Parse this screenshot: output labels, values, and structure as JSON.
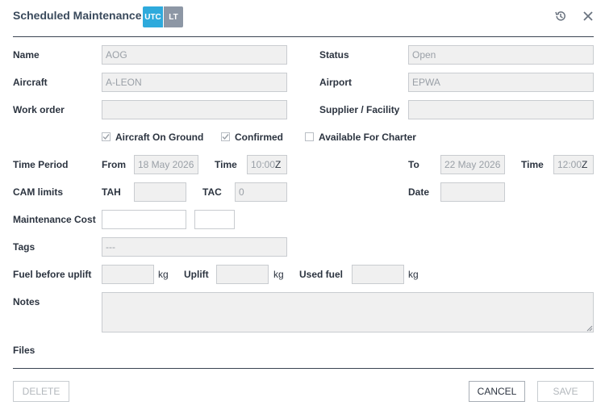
{
  "header": {
    "title": "Scheduled Maintenance",
    "tz_utc": "UTC",
    "tz_lt": "LT",
    "history_icon": "history-icon",
    "close_icon": "close-icon"
  },
  "labels": {
    "name": "Name",
    "status": "Status",
    "aircraft": "Aircraft",
    "airport": "Airport",
    "work_order": "Work order",
    "supplier": "Supplier / Facility",
    "time_period": "Time Period",
    "from": "From",
    "time": "Time",
    "to": "To",
    "cam_limits": "CAM limits",
    "tah": "TAH",
    "tac": "TAC",
    "date": "Date",
    "maintenance_cost": "Maintenance Cost",
    "tags": "Tags",
    "fuel_before_uplift": "Fuel before uplift",
    "uplift": "Uplift",
    "used_fuel": "Used fuel",
    "notes": "Notes",
    "files": "Files",
    "kg": "kg"
  },
  "fields": {
    "name": "AOG",
    "status": "Open",
    "aircraft": "A-LEON",
    "airport": "EPWA",
    "work_order": "",
    "supplier": "",
    "from_date": "18 May 2026",
    "from_time": "10:00",
    "to_date": "22 May 2026",
    "to_time": "12:00",
    "time_suffix": "Z",
    "tah": "",
    "tac": "0",
    "cam_date": "",
    "maintenance_cost": "",
    "maintenance_currency": "",
    "tags": "---",
    "fuel_before_uplift": "",
    "uplift": "",
    "used_fuel": "",
    "notes": ""
  },
  "checkboxes": [
    {
      "label": "Aircraft On Ground",
      "checked": true
    },
    {
      "label": "Confirmed",
      "checked": true
    },
    {
      "label": "Available For Charter",
      "checked": false
    }
  ],
  "buttons": {
    "delete": "Delete",
    "cancel": "Cancel",
    "save": "Save"
  }
}
